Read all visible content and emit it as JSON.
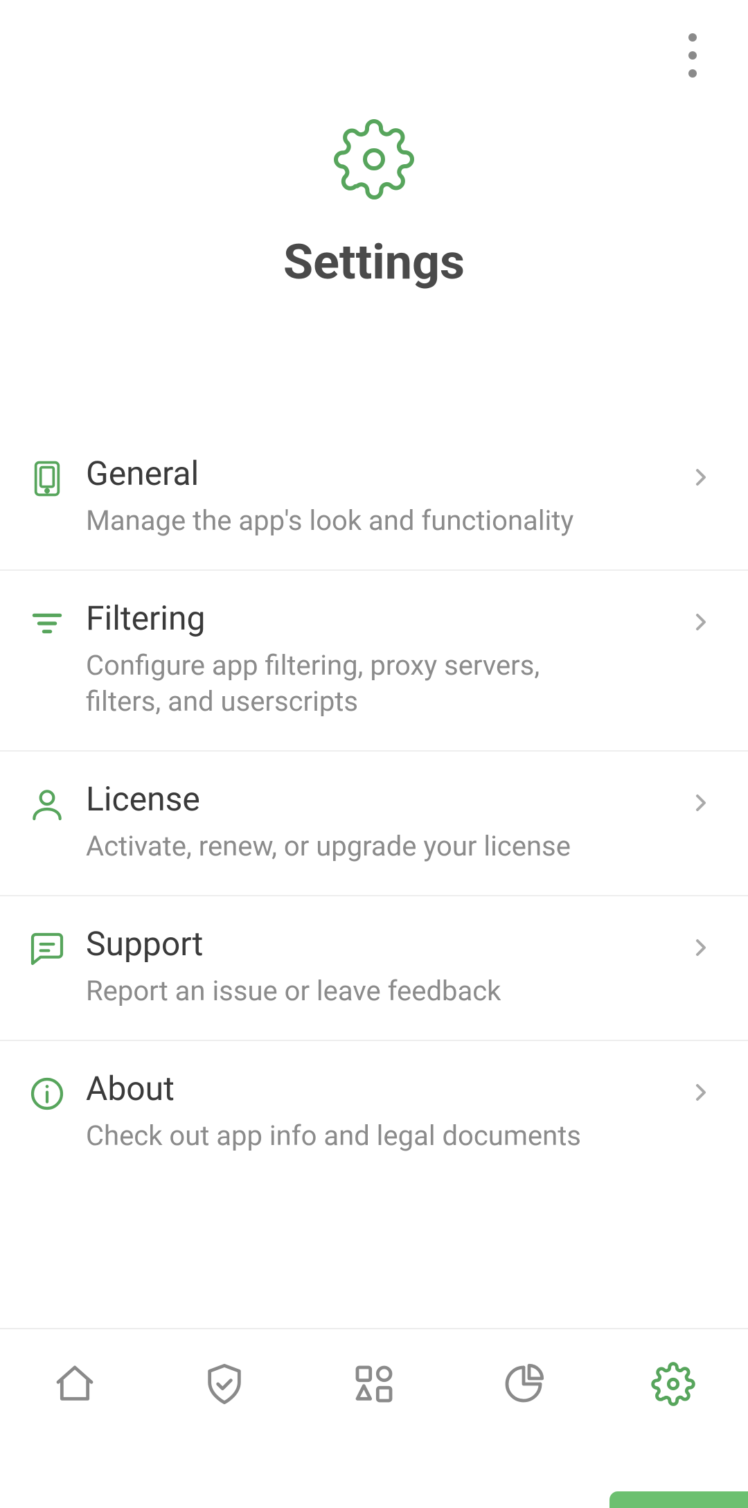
{
  "colors": {
    "accent": "#57a55c",
    "text": "#3a3a3a",
    "muted": "#8b8b8b",
    "divider": "#eeeeee"
  },
  "header": {
    "title": "Settings"
  },
  "menu_button": {
    "name": "More options"
  },
  "items": [
    {
      "label": "General",
      "desc": "Manage the app's look and functionality",
      "icon": "phone-icon"
    },
    {
      "label": "Filtering",
      "desc": "Configure app filtering, proxy servers, filters, and userscripts",
      "icon": "filter-icon"
    },
    {
      "label": "License",
      "desc": "Activate, renew, or upgrade your license",
      "icon": "user-icon"
    },
    {
      "label": "Support",
      "desc": "Report an issue or leave feedback",
      "icon": "chat-icon"
    },
    {
      "label": "About",
      "desc": "Check out app info and legal documents",
      "icon": "info-icon"
    }
  ],
  "bottom_nav": [
    {
      "name": "home-tab",
      "icon": "home-icon",
      "active": false
    },
    {
      "name": "protection-tab",
      "icon": "shield-icon",
      "active": false
    },
    {
      "name": "apps-tab",
      "icon": "shapes-icon",
      "active": false
    },
    {
      "name": "stats-tab",
      "icon": "piechart-icon",
      "active": false
    },
    {
      "name": "settings-tab",
      "icon": "gear-icon",
      "active": true
    }
  ]
}
